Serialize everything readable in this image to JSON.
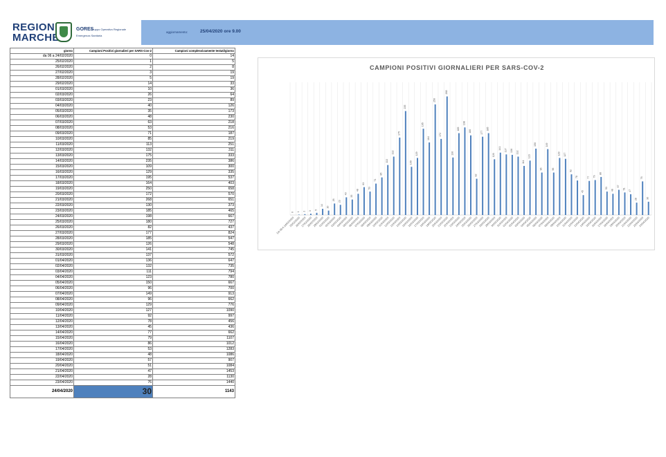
{
  "header": {
    "logo_text": "REGIONE\nMARCHE",
    "org_name": "GORES",
    "org_desc_1": "Gruppo Operativo Regionale",
    "org_desc_2": "Emergenza Sanitaria",
    "update_label": "aggiornamento:",
    "update_value": "25/04/2020 ore 9.00"
  },
  "colors": {
    "header_band": "#8db3e2",
    "bar": "#4f81bd",
    "brand_text": "#1f3f77"
  },
  "table": {
    "columns": [
      "giorno",
      "Campioni Positivi giornalieri per SARS-Cov-2",
      "Campioni complessivamente testati/giorno"
    ],
    "rows": [
      [
        "da 06 a 24/02/2020",
        "0",
        "14"
      ],
      [
        "25/02/2020",
        "1",
        "5"
      ],
      [
        "26/02/2020",
        "2",
        "8"
      ],
      [
        "27/02/2020",
        "3",
        "19"
      ],
      [
        "28/02/2020",
        "5",
        "19"
      ],
      [
        "29/02/2020",
        "14",
        "33"
      ],
      [
        "01/03/2020",
        "10",
        "36"
      ],
      [
        "02/03/2020",
        "26",
        "64"
      ],
      [
        "03/03/2020",
        "23",
        "89"
      ],
      [
        "04/03/2020",
        "40",
        "126"
      ],
      [
        "05/03/2020",
        "35",
        "173"
      ],
      [
        "06/03/2020",
        "48",
        "230"
      ],
      [
        "07/03/2020",
        "63",
        "218"
      ],
      [
        "08/03/2020",
        "53",
        "216"
      ],
      [
        "09/03/2020",
        "71",
        "187"
      ],
      [
        "10/03/2020",
        "85",
        "219"
      ],
      [
        "11/03/2020",
        "113",
        "251"
      ],
      [
        "12/03/2020",
        "132",
        "311"
      ],
      [
        "13/03/2020",
        "175",
        "333"
      ],
      [
        "14/03/2020",
        "235",
        "386"
      ],
      [
        "15/03/2020",
        "109",
        "300"
      ],
      [
        "16/03/2020",
        "129",
        "335"
      ],
      [
        "17/03/2020",
        "195",
        "537"
      ],
      [
        "18/03/2020",
        "164",
        "403"
      ],
      [
        "19/03/2020",
        "250",
        "658"
      ],
      [
        "20/03/2020",
        "172",
        "570"
      ],
      [
        "21/03/2020",
        "268",
        "651"
      ],
      [
        "22/03/2020",
        "130",
        "373"
      ],
      [
        "23/03/2020",
        "185",
        "465"
      ],
      [
        "24/03/2020",
        "198",
        "667"
      ],
      [
        "25/03/2020",
        "180",
        "727"
      ],
      [
        "26/03/2020",
        "82",
        "437"
      ],
      [
        "27/03/2020",
        "177",
        "824"
      ],
      [
        "28/03/2020",
        "185",
        "547"
      ],
      [
        "29/03/2020",
        "126",
        "548"
      ],
      [
        "30/03/2020",
        "141",
        "745"
      ],
      [
        "31/03/2020",
        "137",
        "572"
      ],
      [
        "01/04/2020",
        "136",
        "647"
      ],
      [
        "02/04/2020",
        "132",
        "735"
      ],
      [
        "03/04/2020",
        "111",
        "794"
      ],
      [
        "04/04/2020",
        "123",
        "780"
      ],
      [
        "05/04/2020",
        "150",
        "667"
      ],
      [
        "06/04/2020",
        "96",
        "700"
      ],
      [
        "07/04/2020",
        "149",
        "913"
      ],
      [
        "08/04/2020",
        "96",
        "662"
      ],
      [
        "09/04/2020",
        "129",
        "776"
      ],
      [
        "10/04/2020",
        "127",
        "1090"
      ],
      [
        "11/04/2020",
        "92",
        "997"
      ],
      [
        "12/04/2020",
        "78",
        "456"
      ],
      [
        "13/04/2020",
        "45",
        "436"
      ],
      [
        "14/04/2020",
        "77",
        "662"
      ],
      [
        "15/04/2020",
        "79",
        "1107"
      ],
      [
        "16/04/2020",
        "86",
        "1012"
      ],
      [
        "17/04/2020",
        "53",
        "1283"
      ],
      [
        "18/04/2020",
        "48",
        "1086"
      ],
      [
        "19/04/2020",
        "57",
        "907"
      ],
      [
        "20/04/2020",
        "51",
        "1084"
      ],
      [
        "21/04/2020",
        "47",
        "1453"
      ],
      [
        "22/04/2020",
        "28",
        "1130"
      ],
      [
        "23/04/2020",
        "76",
        "1440"
      ]
    ],
    "total_row": [
      "24/04/2020",
      "30",
      "1143"
    ]
  },
  "chart_data": {
    "type": "bar",
    "title": "CAMPIONI POSITIVI GIORNALIERI PER SARS-COV-2",
    "xlabel": "",
    "ylabel": "",
    "grid": true,
    "categories": [
      "DA 06 A 24/02/2020",
      "25/02/2020",
      "26/02/2020",
      "27/02/2020",
      "28/02/2020",
      "29/02/2020",
      "01/03/2020",
      "02/03/2020",
      "03/03/2020",
      "04/03/2020",
      "05/03/2020",
      "06/03/2020",
      "07/03/2020",
      "08/03/2020",
      "09/03/2020",
      "10/03/2020",
      "11/03/2020",
      "12/03/2020",
      "13/03/2020",
      "14/03/2020",
      "15/03/2020",
      "16/03/2020",
      "17/03/2020",
      "18/03/2020",
      "19/03/2020",
      "20/03/2020",
      "21/03/2020",
      "22/03/2020",
      "23/03/2020",
      "24/03/2020",
      "25/03/2020",
      "26/03/2020",
      "27/03/2020",
      "28/03/2020",
      "29/03/2020",
      "30/03/2020",
      "31/03/2020",
      "01/04/2020",
      "02/04/2020",
      "03/04/2020",
      "04/04/2020",
      "05/04/2020",
      "06/04/2020",
      "07/04/2020",
      "08/04/2020",
      "09/04/2020",
      "10/04/2020",
      "11/04/2020",
      "12/04/2020",
      "13/04/2020",
      "14/04/2020",
      "15/04/2020",
      "16/04/2020",
      "17/04/2020",
      "18/04/2020",
      "19/04/2020",
      "20/04/2020",
      "21/04/2020",
      "22/04/2020",
      "23/04/2020",
      "24/04/2020"
    ],
    "values": [
      0,
      1,
      2,
      3,
      5,
      14,
      10,
      26,
      23,
      40,
      35,
      48,
      63,
      53,
      71,
      85,
      113,
      132,
      175,
      235,
      109,
      129,
      195,
      164,
      250,
      172,
      268,
      130,
      185,
      198,
      180,
      82,
      177,
      185,
      126,
      141,
      137,
      136,
      132,
      111,
      123,
      150,
      96,
      149,
      96,
      129,
      127,
      92,
      78,
      45,
      77,
      79,
      86,
      53,
      48,
      57,
      51,
      47,
      28,
      76,
      30
    ],
    "ylim": [
      0,
      300
    ]
  }
}
